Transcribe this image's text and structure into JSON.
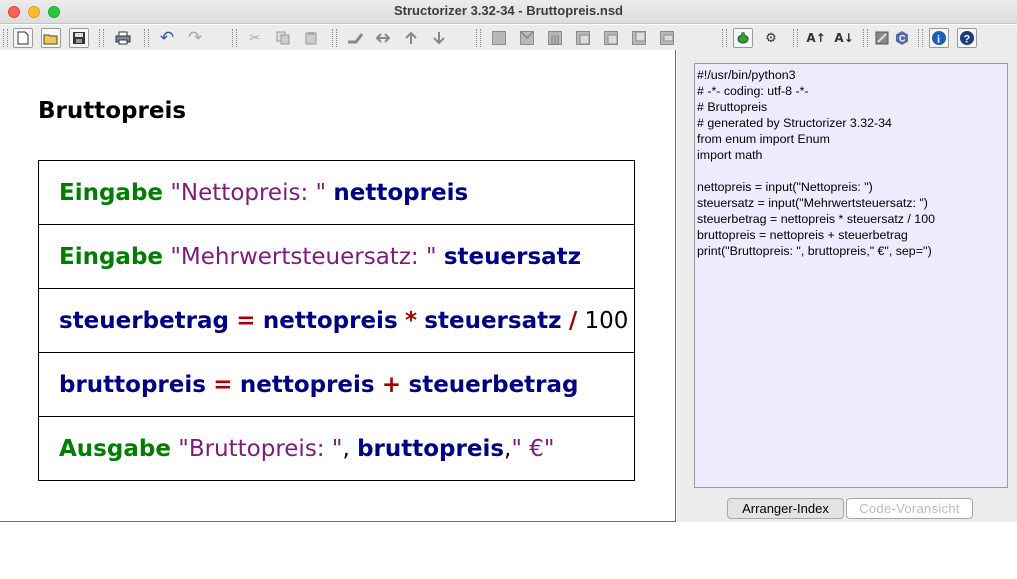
{
  "window": {
    "title": "Structorizer 3.32-34 - Bruttopreis.nsd"
  },
  "diagram": {
    "title": "Bruttopreis",
    "rows": [
      {
        "parts": [
          {
            "t": "Eingabe",
            "c": "kw"
          },
          {
            "t": " ",
            "c": "plain"
          },
          {
            "t": "\"Nettopreis: \"",
            "c": "str"
          },
          {
            "t": " ",
            "c": "plain"
          },
          {
            "t": "nettopreis",
            "c": "var"
          }
        ]
      },
      {
        "parts": [
          {
            "t": "Eingabe",
            "c": "kw"
          },
          {
            "t": " ",
            "c": "plain"
          },
          {
            "t": "\"Mehrwertsteuersatz: \"",
            "c": "str"
          },
          {
            "t": " ",
            "c": "plain"
          },
          {
            "t": "steuersatz",
            "c": "var"
          }
        ]
      },
      {
        "parts": [
          {
            "t": "steuerbetrag",
            "c": "var"
          },
          {
            "t": " ",
            "c": "plain"
          },
          {
            "t": "=",
            "c": "op"
          },
          {
            "t": " ",
            "c": "plain"
          },
          {
            "t": "nettopreis",
            "c": "var"
          },
          {
            "t": " ",
            "c": "plain"
          },
          {
            "t": "*",
            "c": "op"
          },
          {
            "t": " ",
            "c": "plain"
          },
          {
            "t": "steuersatz",
            "c": "var"
          },
          {
            "t": " ",
            "c": "plain"
          },
          {
            "t": "/",
            "c": "op"
          },
          {
            "t": " ",
            "c": "plain"
          },
          {
            "t": "100",
            "c": "num"
          }
        ]
      },
      {
        "parts": [
          {
            "t": "bruttopreis",
            "c": "var"
          },
          {
            "t": " ",
            "c": "plain"
          },
          {
            "t": "=",
            "c": "op"
          },
          {
            "t": " ",
            "c": "plain"
          },
          {
            "t": "nettopreis",
            "c": "var"
          },
          {
            "t": " ",
            "c": "plain"
          },
          {
            "t": "+",
            "c": "op"
          },
          {
            "t": " ",
            "c": "plain"
          },
          {
            "t": "steuerbetrag",
            "c": "var"
          }
        ]
      },
      {
        "parts": [
          {
            "t": "Ausgabe",
            "c": "kw"
          },
          {
            "t": " ",
            "c": "plain"
          },
          {
            "t": "\"Bruttopreis: \"",
            "c": "str"
          },
          {
            "t": ", ",
            "c": "plain"
          },
          {
            "t": "bruttopreis",
            "c": "var"
          },
          {
            "t": ",",
            "c": "plain"
          },
          {
            "t": "\" €\"",
            "c": "str"
          }
        ]
      }
    ]
  },
  "code_preview": {
    "lines": [
      "#!/usr/bin/python3",
      "# -*- coding: utf-8 -*-",
      "# Bruttopreis",
      "# generated by Structorizer 3.32-34",
      "from enum import Enum",
      "import math",
      "",
      "nettopreis = input(\"Nettopreis: \")",
      "steuersatz = input(\"Mehrwertsteuersatz: \")",
      "steuerbetrag = nettopreis * steuersatz / 100",
      "bruttopreis = nettopreis + steuerbetrag",
      "print(\"Bruttopreis: \", bruttopreis,\" €\", sep='')"
    ]
  },
  "tabs": {
    "arranger": "Arranger-Index",
    "code": "Code-Voransicht"
  },
  "toolbar": {
    "buttons": [
      {
        "name": "new-file-icon",
        "glyph": "🗋"
      },
      {
        "name": "open-folder-icon",
        "glyph": "📂"
      },
      {
        "name": "save-icon",
        "glyph": "💾"
      },
      {
        "name": "print-icon",
        "glyph": "🖶"
      },
      {
        "name": "undo-icon",
        "glyph": "↶"
      },
      {
        "name": "redo-icon",
        "glyph": "↷"
      },
      {
        "name": "cut-icon",
        "glyph": "✂"
      },
      {
        "name": "copy-icon",
        "glyph": "⧉"
      },
      {
        "name": "paste-icon",
        "glyph": "📋"
      },
      {
        "name": "move-up-icon",
        "glyph": "⇡"
      },
      {
        "name": "transmute-icon",
        "glyph": "⇄"
      },
      {
        "name": "outdent-icon",
        "glyph": "⇞"
      },
      {
        "name": "indent-icon",
        "glyph": "⇟"
      },
      {
        "name": "turtle-icon",
        "glyph": "🐢"
      },
      {
        "name": "settings-gear-icon",
        "glyph": "⚙"
      },
      {
        "name": "font-up-icon",
        "glyph": "A↑"
      },
      {
        "name": "font-down-icon",
        "glyph": "A↓"
      },
      {
        "name": "export-icon",
        "glyph": "⇲"
      },
      {
        "name": "cpp-icon",
        "glyph": "C"
      },
      {
        "name": "info-icon",
        "glyph": "i"
      },
      {
        "name": "help-icon",
        "glyph": "?"
      }
    ]
  }
}
